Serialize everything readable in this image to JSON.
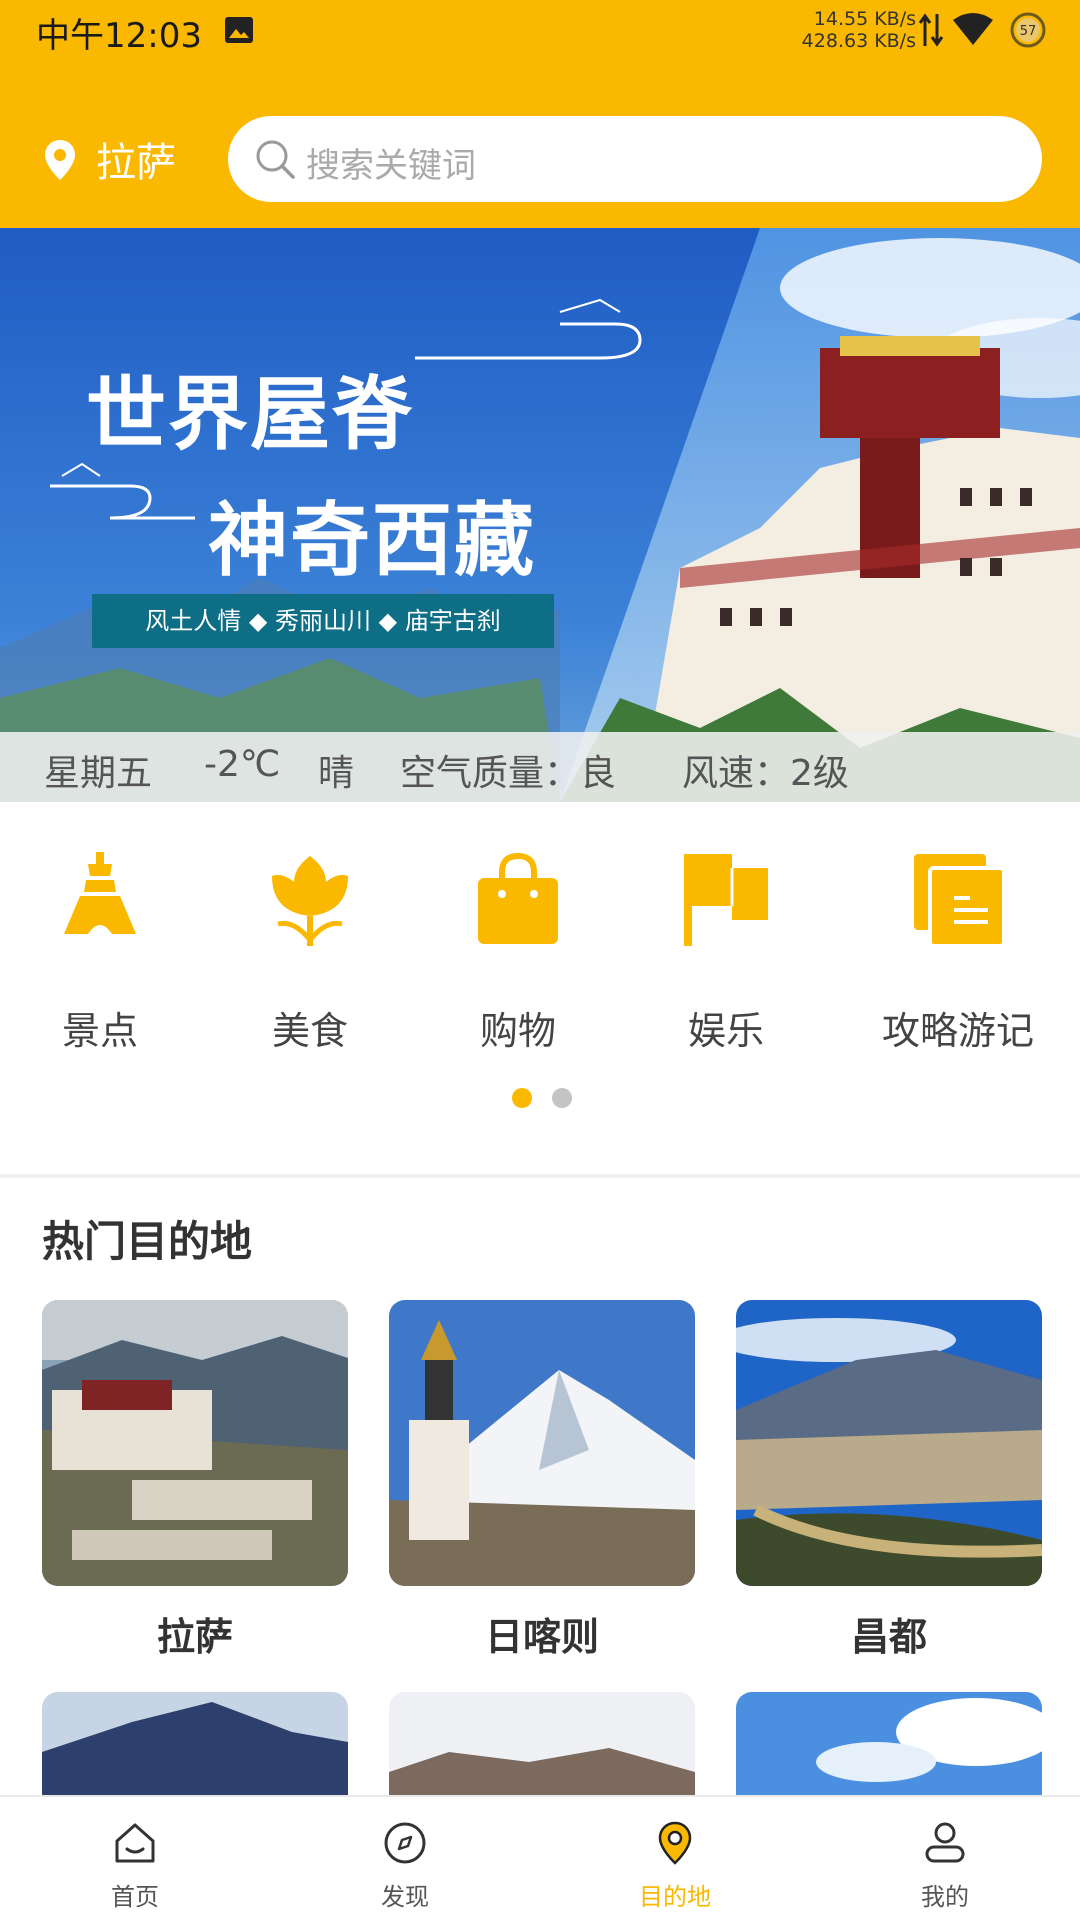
{
  "status_bar": {
    "time": "中午12:03",
    "net_up": "14.55 KB/s",
    "net_down": "428.63 KB/s",
    "battery": "57"
  },
  "header": {
    "location": "拉萨",
    "search_placeholder": "搜索关键词"
  },
  "banner": {
    "title_line1": "世界屋脊",
    "title_line2": "神奇西藏",
    "tags": "风土人情 ◆ 秀丽山川 ◆ 庙宇古刹"
  },
  "weather": {
    "day": "星期五",
    "temp": "-2℃",
    "condition": "晴",
    "air_quality": "空气质量：良",
    "wind": "风速：2级"
  },
  "categories": [
    {
      "label": "景点",
      "icon": "tower-icon"
    },
    {
      "label": "美食",
      "icon": "flower-icon"
    },
    {
      "label": "购物",
      "icon": "shopping-bag-icon"
    },
    {
      "label": "娱乐",
      "icon": "flag-icon"
    },
    {
      "label": "攻略游记",
      "icon": "document-icon"
    }
  ],
  "pagination": {
    "current": 1,
    "total": 2
  },
  "popular": {
    "title": "热门目的地",
    "items": [
      {
        "label": "拉萨"
      },
      {
        "label": "日喀则"
      },
      {
        "label": "昌都"
      }
    ]
  },
  "nav": {
    "items": [
      {
        "label": "首页",
        "icon": "home-icon"
      },
      {
        "label": "发现",
        "icon": "compass-icon"
      },
      {
        "label": "目的地",
        "icon": "location-pin-icon"
      },
      {
        "label": "我的",
        "icon": "user-icon"
      }
    ],
    "active": 2
  },
  "colors": {
    "accent": "#FBB800",
    "banner_blue": "#2B6FD0"
  }
}
